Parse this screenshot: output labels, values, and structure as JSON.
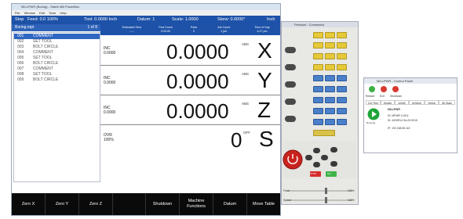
{
  "window": {
    "title": "MILLPWR (Boring) - Starte Mill PowerBox"
  },
  "menu": [
    "File",
    "Window",
    "Edit",
    "Tools",
    "Help"
  ],
  "status": {
    "state": "Stop",
    "feed": "Feed: 0.0 100%",
    "tool": "Tool: 0.0000 Inch",
    "datum": "Datum: 1",
    "scale": "Scale: 1.0000",
    "skew": "Skew: 0.0000°",
    "units": "Inch"
  },
  "program": {
    "name": "Boring.mpt",
    "position": "1 of 8",
    "rows": [
      {
        "n": "001",
        "text": "COMMENT"
      },
      {
        "n": "002",
        "text": "SET TOOL"
      },
      {
        "n": "003",
        "text": "BOLT CIRCLE"
      },
      {
        "n": "004",
        "text": "COMMENT"
      },
      {
        "n": "005",
        "text": "SET TOOL"
      },
      {
        "n": "006",
        "text": "BOLT CIRCLE"
      },
      {
        "n": "007",
        "text": "COMMENT"
      },
      {
        "n": "008",
        "text": "SET TOOL"
      },
      {
        "n": "009",
        "text": "BOLT CIRCLE"
      }
    ]
  },
  "dro_header": [
    {
      "label": "Estimated Time",
      "value": "--:--"
    },
    {
      "label": "Part Count",
      "value": "0:00:00"
    },
    {
      "label": "Parts",
      "value": "0"
    },
    {
      "label": "Job Count",
      "value": "1 job"
    },
    {
      "label": "Time of Day",
      "value": "4:17 pm"
    }
  ],
  "axes": [
    {
      "letter": "X",
      "inc_label": "INC",
      "inc_value": "0.0000",
      "value": "0.0000",
      "mode": "ABS"
    },
    {
      "letter": "Y",
      "inc_label": "INC",
      "inc_value": "0.0000",
      "value": "0.0000",
      "mode": "ABS"
    },
    {
      "letter": "Z",
      "inc_label": "INC",
      "inc_value": "0.0000",
      "value": "0.0000",
      "mode": "ABS"
    },
    {
      "letter": "S",
      "inc_label": "OVR",
      "inc_value": "100%",
      "value": "0",
      "mode": "OFF"
    }
  ],
  "fkeys": [
    "Zero X",
    "Zero Y",
    "Zero Z",
    "",
    "Shutdown",
    "Machine Functions",
    "Datum",
    "Move Table"
  ],
  "pendant": {
    "title": "Pendant - Connected",
    "feed_label": "Feed",
    "speed_label": "Speed",
    "feed_value": "100%",
    "speed_value": "100%",
    "stop_label": "STOP",
    "go_label": "GO"
  },
  "control_panel": {
    "title": "MILLPWR - Control Panel",
    "buttons": [
      "Restart",
      "Exit",
      "Shutdown"
    ],
    "tabs": [
      "Cut Time",
      "Modes",
      "Inhibit",
      "UnWork",
      "Verbal",
      "All Stats"
    ],
    "device": "MILLPWR",
    "lines": [
      "ID: MPWR 0.45.6",
      "ID: 4000R14 Sw:20.0015",
      "IP: 192.168.55.115"
    ],
    "running_label": "Running"
  }
}
